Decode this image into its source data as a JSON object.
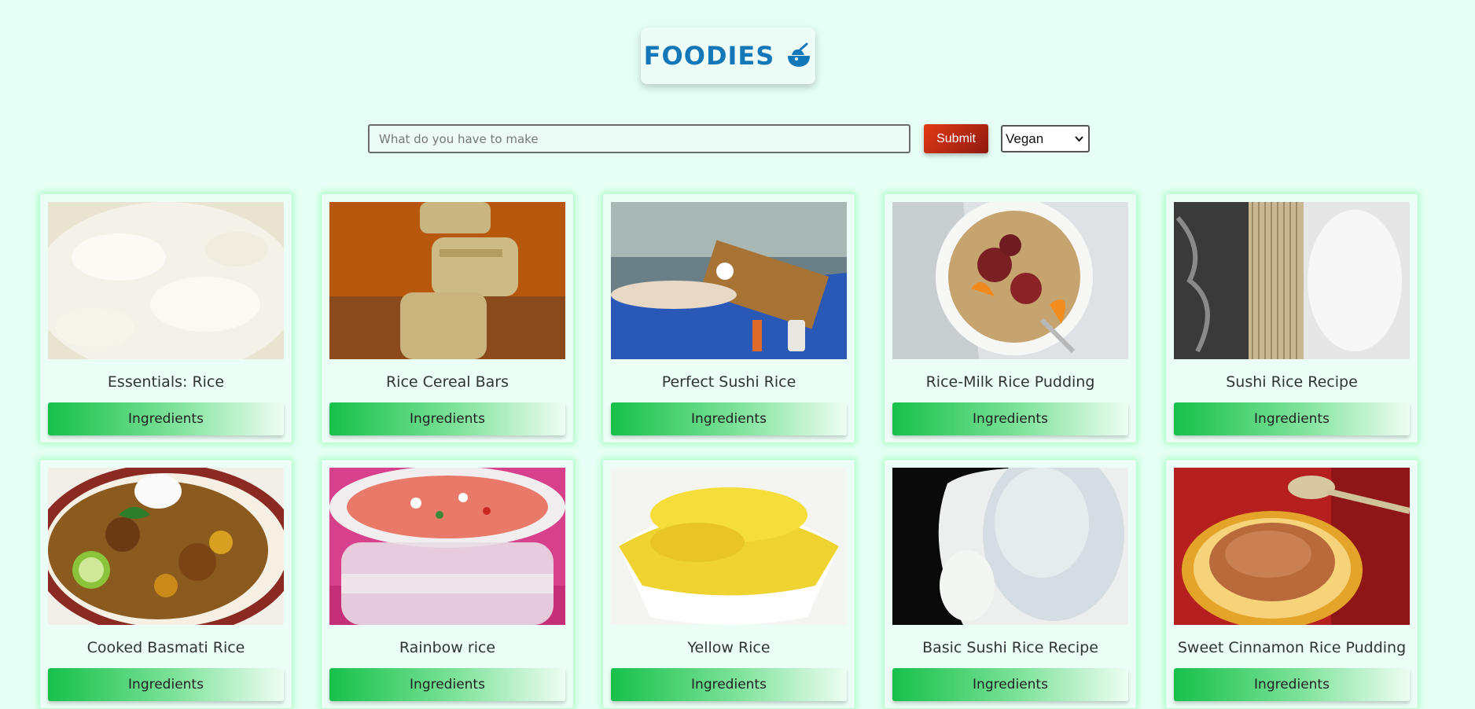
{
  "header": {
    "logo_text": "FOODIES",
    "logo_icon": "food-bowl-icon"
  },
  "search": {
    "placeholder": "What do you have to make",
    "value": ""
  },
  "submit_label": "Submit",
  "diet_select": {
    "selected": "Vegan"
  },
  "card_button_label": "Ingredients",
  "colors": {
    "background": "#e6fff6",
    "logo": "#1478b8",
    "submit": "#c8290f",
    "ingredients": "#17c04a"
  },
  "recipes": [
    {
      "title": "Essentials: Rice",
      "image": "white-rice"
    },
    {
      "title": "Rice Cereal Bars",
      "image": "cereal-bars"
    },
    {
      "title": "Perfect Sushi Rice",
      "image": "sushi-prep"
    },
    {
      "title": "Rice-Milk Rice Pudding",
      "image": "pudding-bowl"
    },
    {
      "title": "Sushi Rice Recipe",
      "image": "sushi-mat"
    },
    {
      "title": "Cooked Basmati Rice",
      "image": "curry-plate"
    },
    {
      "title": "Rainbow rice",
      "image": "rainbow-container"
    },
    {
      "title": "Yellow Rice",
      "image": "yellow-rice-bowl"
    },
    {
      "title": "Basic Sushi Rice Recipe",
      "image": "rice-spoon"
    },
    {
      "title": "Sweet Cinnamon Rice Pudding",
      "image": "cinnamon-pudding"
    }
  ]
}
